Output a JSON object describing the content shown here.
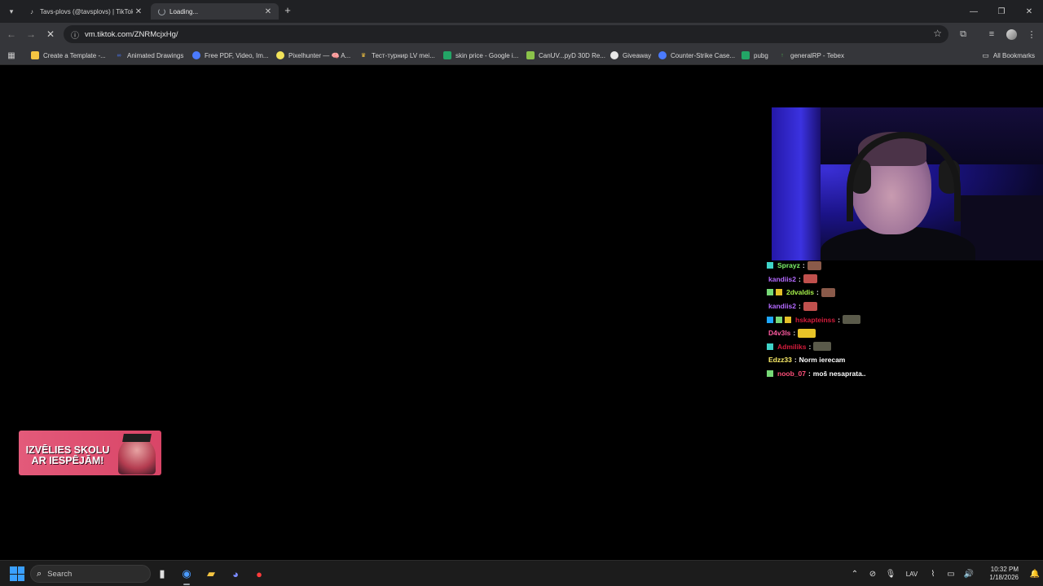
{
  "browser": {
    "tabs": [
      {
        "title": "Tavs-plovs (@tavsplovs) | TikTok",
        "favicon": "tiktok-icon",
        "active": false
      },
      {
        "title": "Loading...",
        "favicon": "loading-spinner",
        "active": true
      }
    ],
    "url": "vm.tiktok.com/ZNRMcjxHg/",
    "bookmarks": [
      {
        "label": "Create a Template -...",
        "icon": "doc-icon",
        "color": "#f5c542"
      },
      {
        "label": "Animated Drawings",
        "icon": "meta-icon",
        "color": "#4b7bff"
      },
      {
        "label": "Free PDF, Video, Im...",
        "icon": "globe-icon",
        "color": "#4b7bff"
      },
      {
        "label": "Pixelhunter — 🧠 A...",
        "icon": "pixel-icon",
        "color": "#f2e35a"
      },
      {
        "label": "Тест-турнир LV mei...",
        "icon": "trophy-icon",
        "color": "#f5c542"
      },
      {
        "label": "skin price - Google i...",
        "icon": "sheets-icon",
        "color": "#23a566"
      },
      {
        "label": "CanUV...pyD 30D Re...",
        "icon": "leaf-icon",
        "color": "#8bc34a"
      },
      {
        "label": "Giveaway",
        "icon": "gift-icon",
        "color": "#e8e8e8"
      },
      {
        "label": "Counter-Strike Case...",
        "icon": "cs-icon",
        "color": "#4b7bff"
      },
      {
        "label": "pubg",
        "icon": "sheets-icon",
        "color": "#23a566"
      },
      {
        "label": "generalRP - Tebex",
        "icon": "tebex-icon",
        "color": "#4caf50"
      }
    ],
    "all_bookmarks_label": "All Bookmarks"
  },
  "chat": [
    {
      "badges": [
        "#3fd3c8"
      ],
      "user": "Sprayz",
      "user_color": "#7cf36b",
      "message": "",
      "emote": "#8a5a4a",
      "emote_wide": false
    },
    {
      "badges": [],
      "user": "kandiis2",
      "user_color": "#b469ff",
      "message": "",
      "emote": "#c0504d",
      "emote_wide": false
    },
    {
      "badges": [
        "#77d977",
        "#e5c028"
      ],
      "user": "2dvaldis",
      "user_color": "#a6f04a",
      "message": "",
      "emote": "#8a5a4a",
      "emote_wide": false
    },
    {
      "badges": [],
      "user": "kandiis2",
      "user_color": "#b469ff",
      "message": "",
      "emote": "#c0504d",
      "emote_wide": false
    },
    {
      "badges": [
        "#1ea7ff",
        "#77d977",
        "#e5c028"
      ],
      "user": "hskapteinss",
      "user_color": "#d61c3c",
      "message": "",
      "emote": "#5a5a4a",
      "emote_wide": true
    },
    {
      "badges": [],
      "user": "D4v3ls",
      "user_color": "#ff5aa0",
      "message": "",
      "emote": "#e8c428",
      "emote_wide": true
    },
    {
      "badges": [
        "#3fd3c8"
      ],
      "user": "Admiliks",
      "user_color": "#d61c3c",
      "message": "",
      "emote": "#5a5a4a",
      "emote_wide": true
    },
    {
      "badges": [],
      "user": "Edzz33",
      "user_color": "#fff06a",
      "message": "Norm ierecam",
      "emote": "",
      "emote_wide": false
    },
    {
      "badges": [
        "#77d977"
      ],
      "user": "noob_07",
      "user_color": "#ff4f7a",
      "message": "moš nesaprata..",
      "emote": "",
      "emote_wide": false
    }
  ],
  "promo": {
    "line1": "IZVĒLIES SKOLU",
    "line2": "AR IESPĒJĀM!"
  },
  "taskbar": {
    "search_placeholder": "Search",
    "tray_language": "LAV",
    "clock_time": "10:32 PM",
    "clock_date": "1/18/2026"
  },
  "colors": {
    "tab_bg": "#202124",
    "toolbar_bg": "#35363a",
    "accent": "#3aa0ff"
  }
}
